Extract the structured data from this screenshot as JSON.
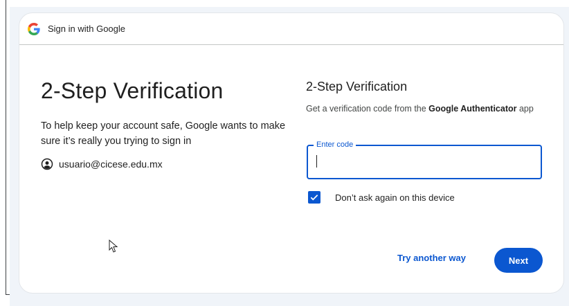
{
  "header": {
    "title": "Sign in with Google",
    "logo_icon": "google-g-icon"
  },
  "left": {
    "title": "2-Step Verification",
    "subtitle": "To help keep your account safe, Google wants to make sure it’s really you trying to sign in",
    "account_icon": "account-circle-icon",
    "email": "usuario@cicese.edu.mx"
  },
  "right": {
    "title": "2-Step Verification",
    "desc_prefix": "Get a verification code from the ",
    "desc_app": "Google Authenticator",
    "desc_suffix": " app",
    "code_field": {
      "label": "Enter code",
      "value": ""
    },
    "remember": {
      "label": "Don’t ask again on this device",
      "checked": true
    }
  },
  "actions": {
    "try_another": "Try another way",
    "next": "Next"
  },
  "colors": {
    "accent": "#0b57d0",
    "text": "#1f1f1f",
    "background": "#f0f4f9"
  }
}
